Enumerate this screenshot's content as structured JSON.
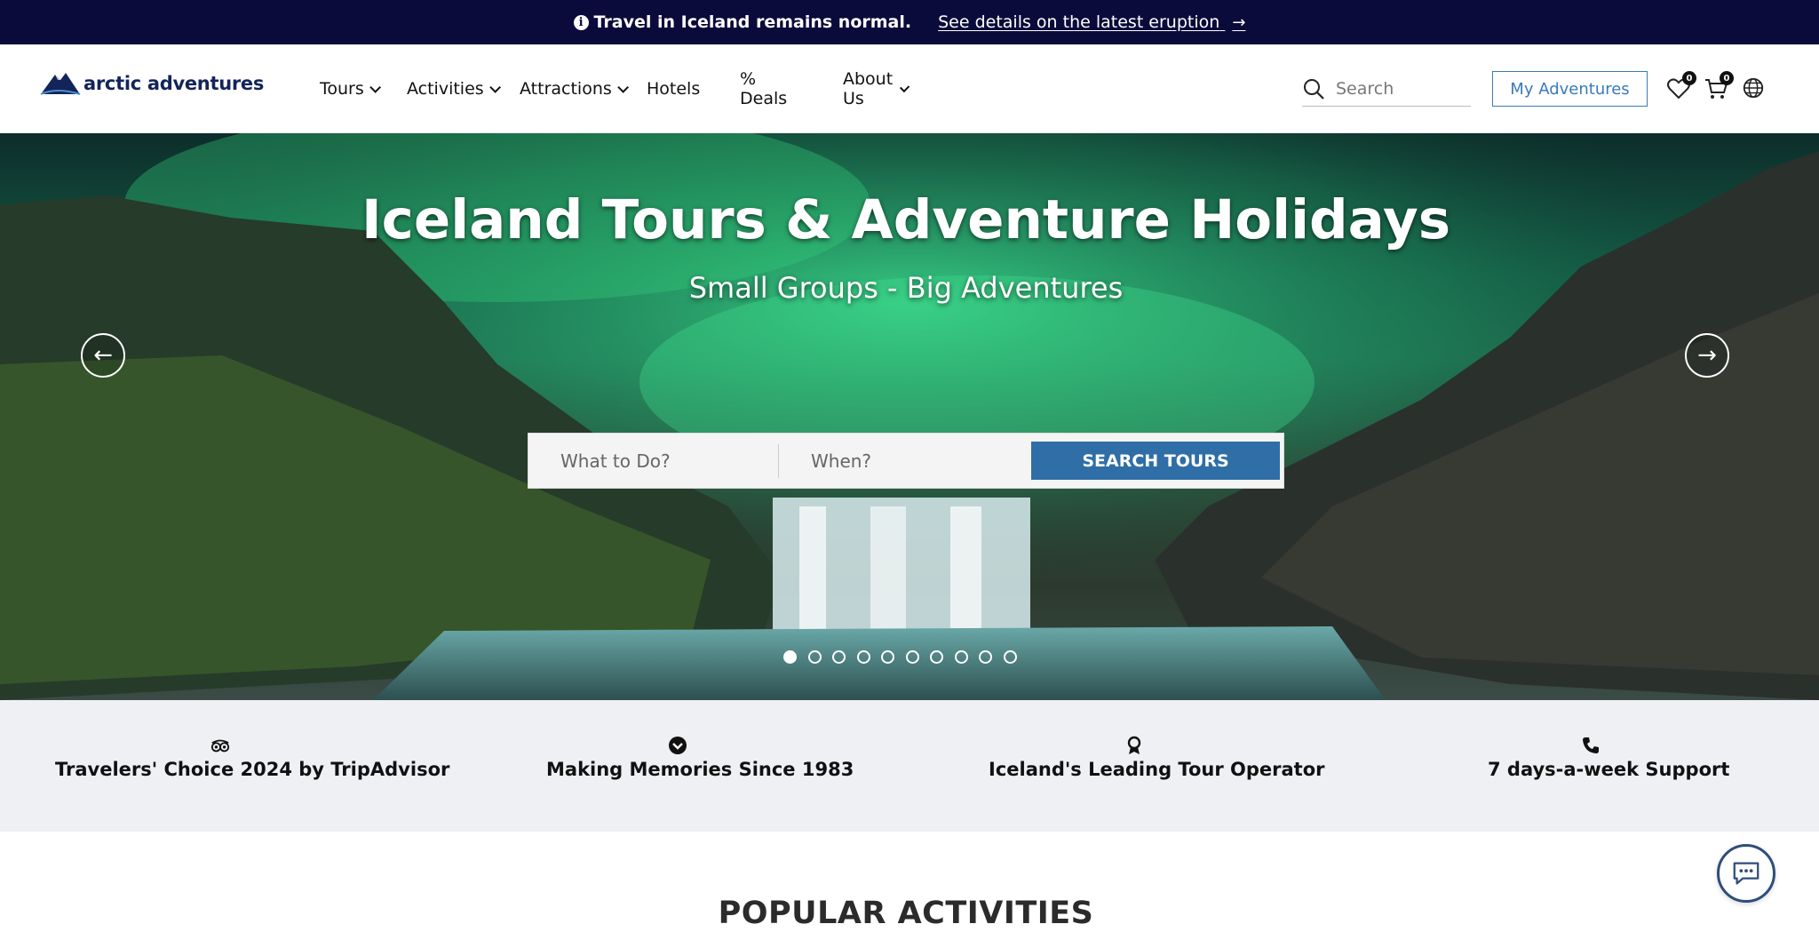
{
  "alert": {
    "text": "Travel in Iceland remains normal.",
    "link": "See details on the latest eruption"
  },
  "brand": {
    "logo_text": "arctic adventures"
  },
  "nav": {
    "tours": "Tours",
    "activities": "Activities",
    "attractions": "Attractions",
    "hotels": "Hotels",
    "deals": "% Deals",
    "about": "About Us"
  },
  "header": {
    "search_placeholder": "Search",
    "my_adventures": "My Adventures",
    "wishlist_count": "0",
    "cart_count": "0"
  },
  "hero": {
    "title": "Iceland Tours & Adventure Holidays",
    "subtitle": "Small Groups - Big Adventures",
    "search_what": "What to Do?",
    "search_when": "When?",
    "search_button": "SEARCH TOURS",
    "slides_total": 10,
    "active_slide": 1
  },
  "features": {
    "f1": "Travelers' Choice 2024 by TripAdvisor",
    "f2": "Making Memories Since 1983",
    "f3": "Iceland's Leading Tour Operator",
    "f4": "7 days-a-week Support"
  },
  "sections": {
    "popular": "POPULAR ACTIVITIES"
  },
  "colors": {
    "alert_bg": "#0b0b3b",
    "accent": "#3a7ab8",
    "search_button": "#2f6ea6",
    "strip_bg": "#eff0f3"
  },
  "icons": [
    "info-icon",
    "arrow-right-icon",
    "chevron-down-icon",
    "search-icon",
    "heart-icon",
    "cart-icon",
    "globe-icon",
    "arrow-left-icon",
    "tripadvisor-icon",
    "check-circle-icon",
    "award-icon",
    "phone-icon",
    "chat-icon"
  ]
}
